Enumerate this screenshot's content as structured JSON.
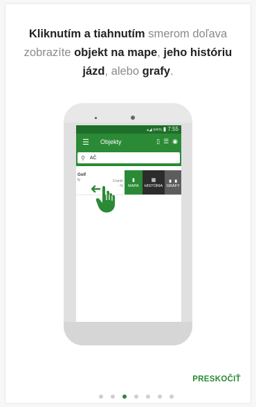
{
  "headline": {
    "l1_b1": "Kliknutím a tiahnutím",
    "l1_n1": " smerom doľava",
    "l2_n1": "zobrazíte ",
    "l2_b1": "objekt na mape",
    "l2_n2": ", ",
    "l2_b2": "jeho históriu",
    "l3_b1": "jázd",
    "l3_n1": ", alebo ",
    "l3_b2": "grafy",
    "l3_n2": "."
  },
  "phone": {
    "status_time": "7:55",
    "status_signal": "64%",
    "app_title": "Objekty",
    "search_value": "AČ",
    "row": {
      "name": "Golf",
      "sub": "ty",
      "speed": "0 km/h",
      "speed2": "- %"
    },
    "actions": {
      "map": "MAPA",
      "history": "HISTÓRIA",
      "graphs": "GRAFY"
    }
  },
  "skip_label": "PRESKOČIŤ",
  "pager": {
    "count": 7,
    "active_index": 2
  },
  "colors": {
    "accent": "#2a8a35",
    "dark_green": "#1f6e2a"
  }
}
